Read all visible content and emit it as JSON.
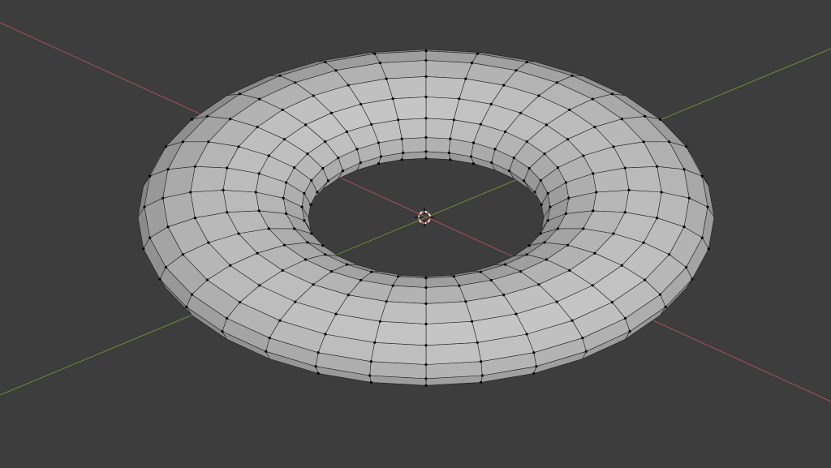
{
  "viewport": {
    "mode": "edit-mode",
    "background_color": "#3d3d3d"
  },
  "axes": {
    "x_axis_color": "#a4505c",
    "y_axis_color": "#6f8a3a"
  },
  "mesh": {
    "type": "torus",
    "major_segments": 32,
    "minor_segments": 16,
    "face_color": "#9e9e9e",
    "edge_color": "#222222",
    "vertex_color": "#000000"
  },
  "cursor_3d": {
    "icon": "3d-cursor-icon",
    "ring_color_a": "#d06060",
    "ring_color_b": "#ffffff"
  }
}
